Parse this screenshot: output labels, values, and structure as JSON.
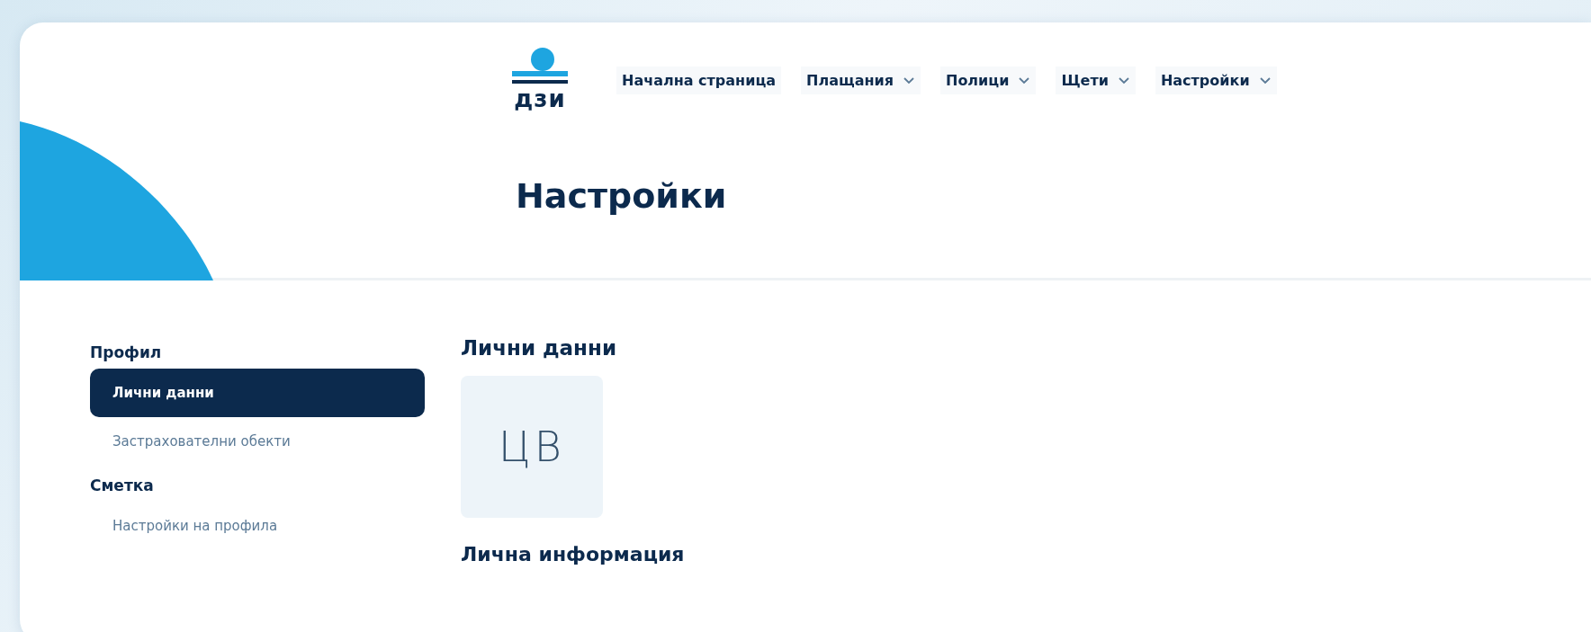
{
  "logo": {
    "text": "дзи"
  },
  "nav": [
    {
      "label": "Начална страница",
      "dropdown": false
    },
    {
      "label": "Плащания",
      "dropdown": true
    },
    {
      "label": "Полици",
      "dropdown": true
    },
    {
      "label": "Щети",
      "dropdown": true
    },
    {
      "label": "Настройки",
      "dropdown": true
    }
  ],
  "page_title": "Настройки",
  "sidebar": [
    {
      "heading": "Профил",
      "items": [
        {
          "label": "Лични данни",
          "selected": true
        },
        {
          "label": "Застрахователни обекти",
          "selected": false
        }
      ]
    },
    {
      "heading": "Сметка",
      "items": [
        {
          "label": "Настройки на профила",
          "selected": false
        }
      ]
    }
  ],
  "content": {
    "heading": "Лични данни",
    "avatar_initials": "ЦВ",
    "section_title": "Лична информация"
  }
}
